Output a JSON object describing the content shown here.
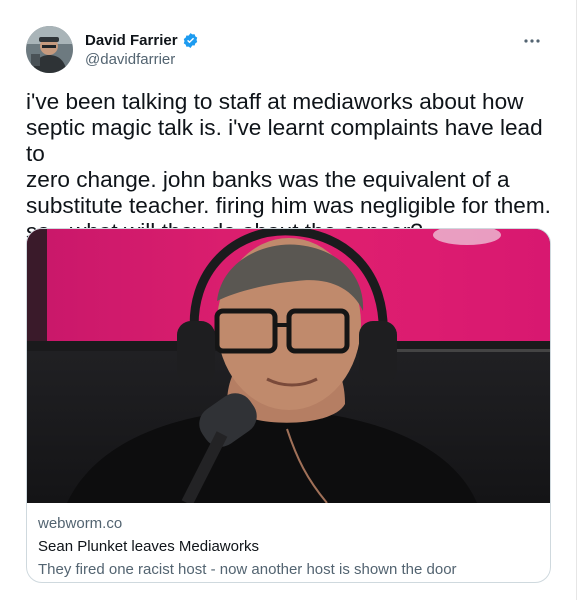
{
  "author": {
    "display_name": "David Farrier",
    "handle": "@davidfarrier",
    "verified": true,
    "avatar_icon": "profile-photo-avatar"
  },
  "menu": {
    "icon": "more-horizontal-icon"
  },
  "tweet": {
    "text": "i've been talking to staff at mediaworks about how\nseptic magic talk is. i've learnt complaints have lead to\nzero change. john banks was the equivalent of a\nsubstitute teacher. firing him was negligible for them.\nso - what will they do about the cancer?"
  },
  "link_card": {
    "image_alt": "man wearing headphones and glasses speaking into a radio microphone",
    "domain": "webworm.co",
    "title": "Sean Plunket leaves Mediaworks",
    "description": "They fired one racist host - now another host is shown the door"
  },
  "colors": {
    "text_primary": "#0f1419",
    "text_secondary": "#536471",
    "verified_blue": "#1d9bf0",
    "card_border": "#cfd9de"
  }
}
